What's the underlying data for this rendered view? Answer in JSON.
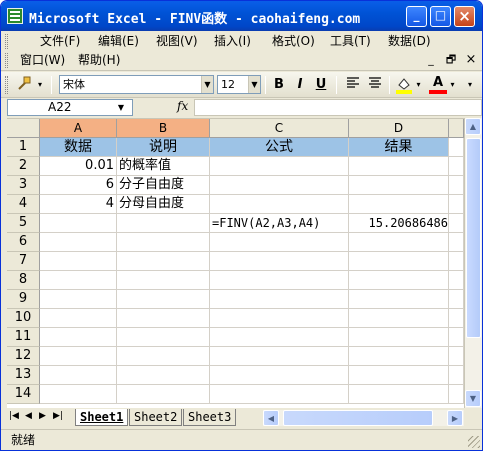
{
  "window": {
    "title": "Microsoft Excel - FINV函数 - caohaifeng.com",
    "controls": {
      "minimize": "_",
      "maximize": "□",
      "close": "×"
    }
  },
  "menubar": {
    "items": [
      "文件(F)",
      "编辑(E)",
      "视图(V)",
      "插入(I)",
      "格式(O)",
      "工具(T)",
      "数据(D)",
      "窗口(W)",
      "帮助(H)"
    ],
    "mdi_controls": {
      "minimize": "_",
      "restore": "🗗",
      "close": "×"
    }
  },
  "toolbar": {
    "font_name": "宋体",
    "font_size": "12",
    "bold": "B",
    "italic": "I",
    "underline": "U",
    "font_color_glyph": "A",
    "icons": [
      "format-painter-icon",
      "align-left-icon",
      "align-center-icon",
      "fill-color-icon",
      "font-color-icon"
    ],
    "colors": {
      "fill": "#ffff00",
      "font": "#ff0000"
    }
  },
  "formula_bar": {
    "name_box": "A22",
    "fx": "fx",
    "formula": ""
  },
  "sheet": {
    "columns": [
      "A",
      "B",
      "C",
      "D"
    ],
    "row_numbers": [
      "1",
      "2",
      "3",
      "4",
      "5",
      "6",
      "7",
      "8",
      "9",
      "10",
      "11",
      "12",
      "13",
      "14"
    ],
    "header_row": [
      "数据",
      "说明",
      "公式",
      "结果"
    ],
    "rows": [
      {
        "a": "0.01",
        "b": "的概率值",
        "c": "",
        "d": ""
      },
      {
        "a": "6",
        "b": "分子自由度",
        "c": "",
        "d": ""
      },
      {
        "a": "4",
        "b": "分母自由度",
        "c": "",
        "d": ""
      },
      {
        "a": "",
        "b": "",
        "c": "=FINV(A2,A3,A4)",
        "d": "15.20686486"
      }
    ],
    "colors": {
      "column_header_highlight": "#f4b084",
      "header_cells": "#9dc3e6"
    }
  },
  "tabs": {
    "sheets": [
      "Sheet1",
      "Sheet2",
      "Sheet3"
    ],
    "active": "Sheet1",
    "nav": [
      "|◀",
      "◀",
      "▶",
      "▶|"
    ]
  },
  "statusbar": {
    "text": "就绪"
  }
}
